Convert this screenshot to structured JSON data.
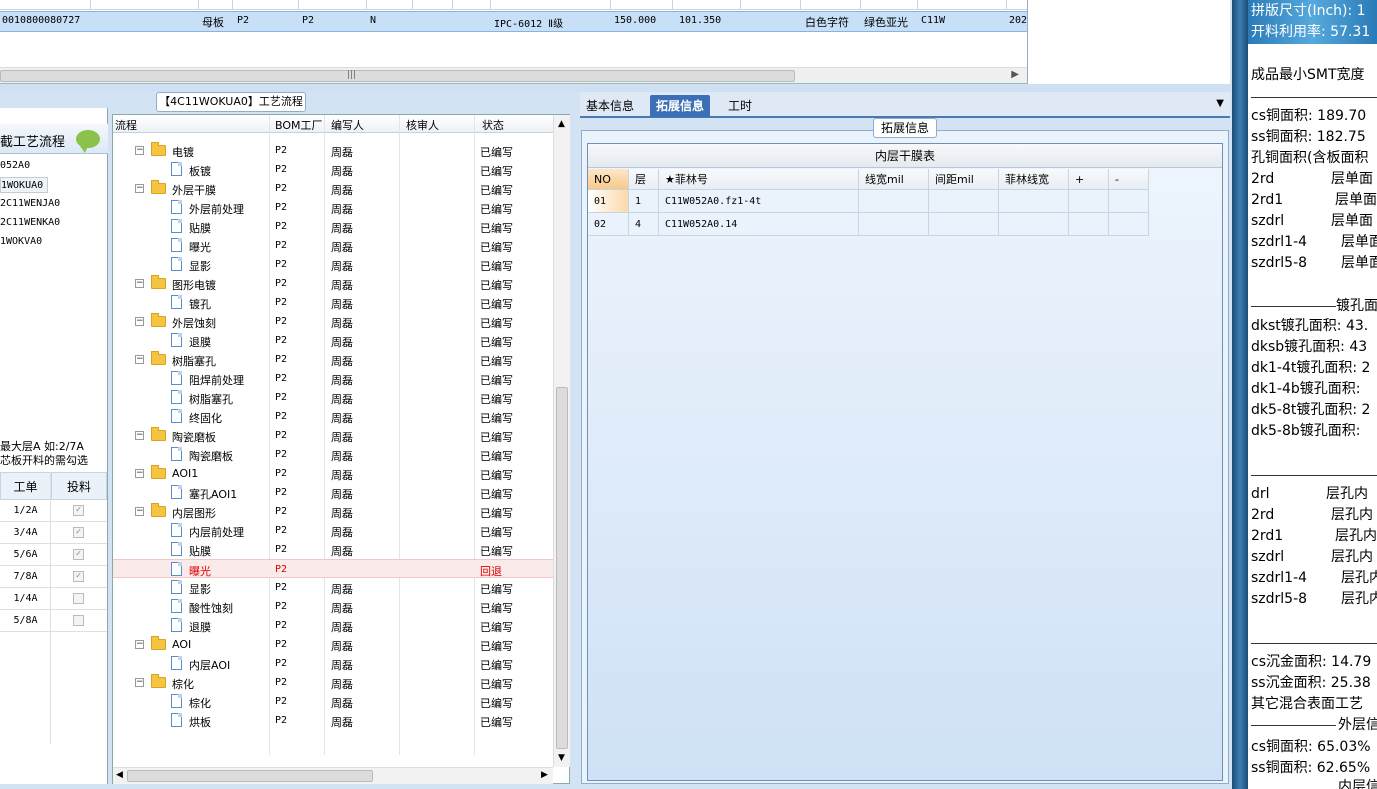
{
  "top_row": {
    "id": "0010800080727",
    "board_type": "母板",
    "col_p2a": "P2",
    "col_p2b": "P2",
    "col_n": "N",
    "standard": "IPC-6012 Ⅱ级",
    "val1": "150.000",
    "val2": "101.350",
    "silk": "白色字符",
    "mask": "绿色亚光",
    "code": "C11W",
    "year": "202"
  },
  "left_panel": {
    "title": "截工艺流程",
    "items": [
      "052A0",
      "1WOKUA0",
      "2C11WENJA0",
      "2C11WENKA0",
      "1WOKVA0"
    ],
    "note_line1": "最大层A 如:2/7A",
    "note_line2": "芯板开料的需勾选",
    "table_headers": [
      "工单",
      "投料"
    ],
    "rows": [
      {
        "order": "1/2A",
        "checked": true
      },
      {
        "order": "3/4A",
        "checked": true
      },
      {
        "order": "5/6A",
        "checked": true
      },
      {
        "order": "7/8A",
        "checked": true
      },
      {
        "order": "1/4A",
        "checked": false
      },
      {
        "order": "5/8A",
        "checked": false
      }
    ]
  },
  "mid_panel": {
    "title": "【4C11WOKUA0】工艺流程",
    "headers": [
      "流程",
      "BOM工厂",
      "编写人",
      "核审人",
      "状态"
    ],
    "rows": [
      {
        "name": "电镀",
        "level": 0,
        "type": "folder",
        "factory": "P2",
        "writer": "周磊",
        "status": "已编写"
      },
      {
        "name": "板镀",
        "level": 1,
        "type": "doc",
        "factory": "P2",
        "writer": "周磊",
        "status": "已编写"
      },
      {
        "name": "外层干膜",
        "level": 0,
        "type": "folder",
        "factory": "P2",
        "writer": "周磊",
        "status": "已编写"
      },
      {
        "name": "外层前处理",
        "level": 1,
        "type": "doc",
        "factory": "P2",
        "writer": "周磊",
        "status": "已编写"
      },
      {
        "name": "贴膜",
        "level": 1,
        "type": "doc",
        "factory": "P2",
        "writer": "周磊",
        "status": "已编写"
      },
      {
        "name": "曝光",
        "level": 1,
        "type": "doc",
        "factory": "P2",
        "writer": "周磊",
        "status": "已编写"
      },
      {
        "name": "显影",
        "level": 1,
        "type": "doc",
        "factory": "P2",
        "writer": "周磊",
        "status": "已编写"
      },
      {
        "name": "图形电镀",
        "level": 0,
        "type": "folder",
        "factory": "P2",
        "writer": "周磊",
        "status": "已编写"
      },
      {
        "name": "镀孔",
        "level": 1,
        "type": "doc",
        "factory": "P2",
        "writer": "周磊",
        "status": "已编写"
      },
      {
        "name": "外层蚀刻",
        "level": 0,
        "type": "folder",
        "factory": "P2",
        "writer": "周磊",
        "status": "已编写"
      },
      {
        "name": "退膜",
        "level": 1,
        "type": "doc",
        "factory": "P2",
        "writer": "周磊",
        "status": "已编写"
      },
      {
        "name": "树脂塞孔",
        "level": 0,
        "type": "folder",
        "factory": "P2",
        "writer": "周磊",
        "status": "已编写"
      },
      {
        "name": "阻焊前处理",
        "level": 1,
        "type": "doc",
        "factory": "P2",
        "writer": "周磊",
        "status": "已编写"
      },
      {
        "name": "树脂塞孔",
        "level": 1,
        "type": "doc",
        "factory": "P2",
        "writer": "周磊",
        "status": "已编写"
      },
      {
        "name": "终固化",
        "level": 1,
        "type": "doc",
        "factory": "P2",
        "writer": "周磊",
        "status": "已编写"
      },
      {
        "name": "陶瓷磨板",
        "level": 0,
        "type": "folder",
        "factory": "P2",
        "writer": "周磊",
        "status": "已编写"
      },
      {
        "name": "陶瓷磨板",
        "level": 1,
        "type": "doc",
        "factory": "P2",
        "writer": "周磊",
        "status": "已编写"
      },
      {
        "name": "AOI1",
        "level": 0,
        "type": "folder",
        "factory": "P2",
        "writer": "周磊",
        "status": "已编写"
      },
      {
        "name": "塞孔AOI1",
        "level": 1,
        "type": "doc",
        "factory": "P2",
        "writer": "周磊",
        "status": "已编写"
      },
      {
        "name": "内层图形",
        "level": 0,
        "type": "folder",
        "factory": "P2",
        "writer": "周磊",
        "status": "已编写"
      },
      {
        "name": "内层前处理",
        "level": 1,
        "type": "doc",
        "factory": "P2",
        "writer": "周磊",
        "status": "已编写"
      },
      {
        "name": "贴膜",
        "level": 1,
        "type": "doc",
        "factory": "P2",
        "writer": "周磊",
        "status": "已编写"
      },
      {
        "name": "曝光",
        "level": 1,
        "type": "doc",
        "factory": "P2",
        "writer": "",
        "status": "回退",
        "selected": true
      },
      {
        "name": "显影",
        "level": 1,
        "type": "doc",
        "factory": "P2",
        "writer": "周磊",
        "status": "已编写"
      },
      {
        "name": "酸性蚀刻",
        "level": 1,
        "type": "doc",
        "factory": "P2",
        "writer": "周磊",
        "status": "已编写"
      },
      {
        "name": "退膜",
        "level": 1,
        "type": "doc",
        "factory": "P2",
        "writer": "周磊",
        "status": "已编写"
      },
      {
        "name": "AOI",
        "level": 0,
        "type": "folder",
        "factory": "P2",
        "writer": "周磊",
        "status": "已编写"
      },
      {
        "name": "内层AOI",
        "level": 1,
        "type": "doc",
        "factory": "P2",
        "writer": "周磊",
        "status": "已编写"
      },
      {
        "name": "棕化",
        "level": 0,
        "type": "folder",
        "factory": "P2",
        "writer": "周磊",
        "status": "已编写"
      },
      {
        "name": "棕化",
        "level": 1,
        "type": "doc",
        "factory": "P2",
        "writer": "周磊",
        "status": "已编写"
      },
      {
        "name": "烘板",
        "level": 1,
        "type": "doc",
        "factory": "P2",
        "writer": "周磊",
        "status": "已编写"
      }
    ]
  },
  "tabs": [
    {
      "label": "基本信息",
      "active": false
    },
    {
      "label": "拓展信息",
      "active": true
    },
    {
      "label": "工时",
      "active": false
    }
  ],
  "ext_panel": {
    "group_label": "拓展信息",
    "table_title": "内层干膜表",
    "headers": [
      "NO",
      "层",
      "★菲林号",
      "线宽mil",
      "间距mil",
      "菲林线宽",
      "+",
      "-"
    ],
    "rows": [
      {
        "no": "01",
        "layer": "1",
        "film": "C11W052A0.fz1-4t"
      },
      {
        "no": "02",
        "layer": "4",
        "film": "C11W052A0.14"
      }
    ]
  },
  "right_info": {
    "panel_size": "拼版尺寸(Inch): 1",
    "utilization": "开料利用率: 57.31",
    "smt": "成品最小SMT宽度",
    "cs_copper": "cs铜面积: 189.70",
    "ss_copper": "ss铜面积: 182.75",
    "hole_copper": "孔铜面积(含板面积",
    "layers_a": [
      {
        "k": "2rd",
        "v": "层单面"
      },
      {
        "k": "2rd1",
        "v": "层单面"
      },
      {
        "k": "szdrl",
        "v": "层单面"
      },
      {
        "k": "szdrl1-4",
        "v": "层单面"
      },
      {
        "k": "szdrl5-8",
        "v": "层单面"
      }
    ],
    "plating_title": "镀孔面",
    "plating": [
      "dkst镀孔面积: 43.",
      "dksb镀孔面积: 43",
      "dk1-4t镀孔面积: 2",
      "dk1-4b镀孔面积:",
      "dk5-8t镀孔面积: 2",
      "dk5-8b镀孔面积:"
    ],
    "layers_b": [
      {
        "k": "drl",
        "v": "层孔内"
      },
      {
        "k": "2rd",
        "v": "层孔内"
      },
      {
        "k": "2rd1",
        "v": "层孔内"
      },
      {
        "k": "szdrl",
        "v": "层孔内"
      },
      {
        "k": "szdrl1-4",
        "v": "层孔内"
      },
      {
        "k": "szdrl5-8",
        "v": "层孔内"
      }
    ],
    "cs_gold": "cs沉金面积: 14.79",
    "ss_gold": "ss沉金面积: 25.38",
    "mixed": "其它混合表面工艺",
    "outer_title": "外层信",
    "cs_ratio": "cs铜面积: 65.03%",
    "ss_ratio": "ss铜面积: 62.65%",
    "inner_title": "内层信"
  }
}
